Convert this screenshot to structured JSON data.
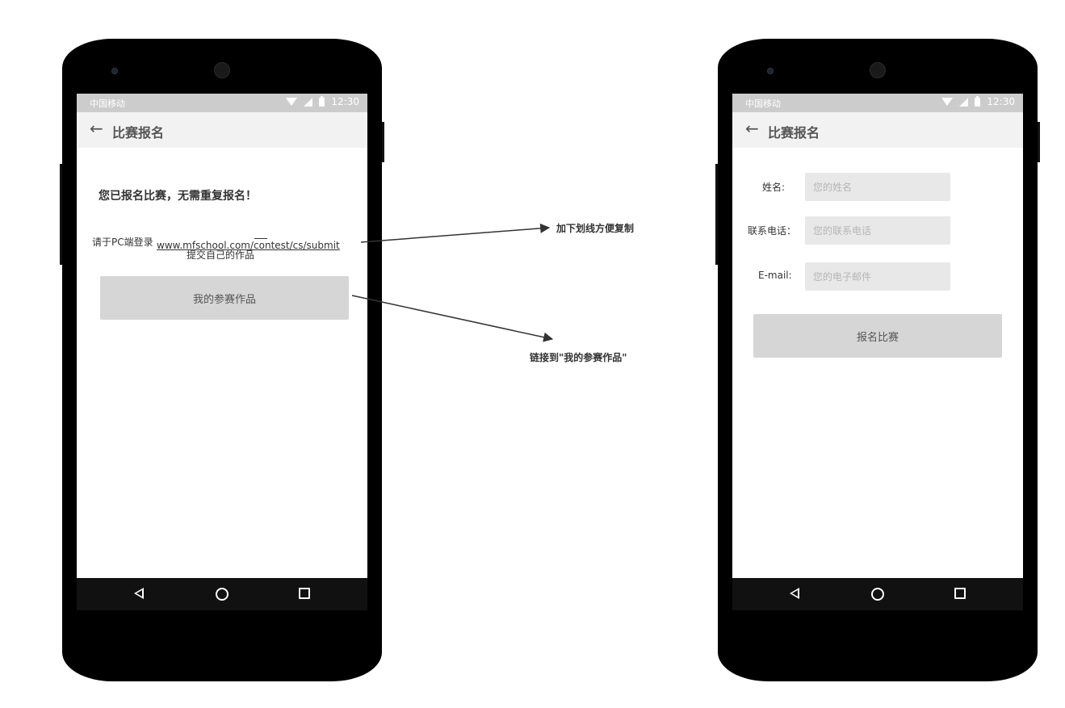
{
  "status_bar": {
    "carrier": "中国移动",
    "time": "12:30"
  },
  "app_bar": {
    "title": "比赛报名"
  },
  "registered_screen": {
    "heading": "您已报名比赛，无需重复报名！",
    "instruction_prefix": "请于PC端登录",
    "link": "www.mfschool.com/contest/cs/submit",
    "instruction_suffix": "提交自己的作品",
    "my_entries_button": "我的参赛作品"
  },
  "form_screen": {
    "name_label": "姓名:",
    "name_placeholder": "您的姓名",
    "phone_label": "联系电话：",
    "phone_placeholder": "您的联系电话",
    "email_label": "E-mail:",
    "email_placeholder": "您的电子邮件",
    "submit_button": "报名比赛"
  },
  "annotations": {
    "underline_note": "加下划线方便复制",
    "link_note": "链接到\"我的参赛作品\""
  }
}
